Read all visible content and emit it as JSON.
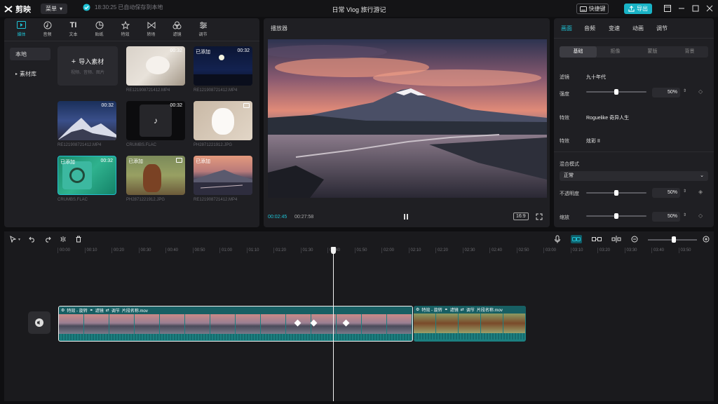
{
  "app": {
    "name": "剪映",
    "menu": "菜单",
    "save_status": "18:30:25 已自动保存到本地",
    "project_title": "日常 Vlog 旅行游记",
    "shortcut": "快捷键",
    "export": "导出"
  },
  "colors": {
    "accent": "#1fc3d6",
    "clip": "#1c7f80",
    "panel": "#1f1f23"
  },
  "media": {
    "tabs": [
      {
        "label": "媒体",
        "icon": "media-icon"
      },
      {
        "label": "音频",
        "icon": "audio-icon"
      },
      {
        "label": "文本",
        "icon": "text-icon"
      },
      {
        "label": "贴纸",
        "icon": "sticker-icon"
      },
      {
        "label": "特效",
        "icon": "effects-icon"
      },
      {
        "label": "转场",
        "icon": "transition-icon"
      },
      {
        "label": "滤镜",
        "icon": "filter-icon"
      },
      {
        "label": "调节",
        "icon": "adjust-icon"
      }
    ],
    "side": [
      "本地",
      "素材库"
    ],
    "import_label": "导入素材",
    "import_hint": "视频、音频、图片",
    "items": [
      {
        "name": "RE121908721412.MP4",
        "duration": "00:32",
        "added": ""
      },
      {
        "name": "RE121908721412.MP4",
        "duration": "00:32",
        "added": "已添加"
      },
      {
        "name": "RE121908721412.MP4",
        "duration": "00:32",
        "added": ""
      },
      {
        "name": "CRUMBS.FLAC",
        "duration": "00:32",
        "added": ""
      },
      {
        "name": "PH2871221912.JPG",
        "duration": "",
        "added": ""
      },
      {
        "name": "CRUMBS.FLAC",
        "duration": "00:32",
        "added": "已添加"
      },
      {
        "name": "PH2871221912.JPG",
        "duration": "",
        "added": "已添加"
      },
      {
        "name": "RE121908721412.MP4",
        "duration": "",
        "added": "已添加"
      }
    ]
  },
  "player": {
    "title": "播放器",
    "current": "00:02:45",
    "total": "00:27:58",
    "ratio": "16:9"
  },
  "props": {
    "tabs": [
      "画面",
      "音频",
      "变速",
      "动画",
      "调节"
    ],
    "segments": [
      "基础",
      "抠像",
      "蒙版",
      "背景"
    ],
    "filter_label": "滤镜",
    "filter_value": "九十年代",
    "strength_label": "强度",
    "strength_value": "50%",
    "strength": 0.5,
    "effect_label": "特效",
    "effect_value": "Roguelike  奇异人生",
    "effect2_label": "特效",
    "effect2_value": "炫彩 II",
    "blend_label": "混合模式",
    "blend_value": "正常",
    "opacity_label": "不透明度",
    "opacity_value": "50%",
    "opacity": 0.5,
    "scale_label": "缩放",
    "scale_value": "50%",
    "scale": 0.5
  },
  "timeline": {
    "ticks": [
      "00:00",
      "00:10",
      "00:20",
      "00:30",
      "00:40",
      "00:50",
      "01:00",
      "01:10",
      "01:20",
      "01:30",
      "01:40",
      "01:50",
      "02:00",
      "02:10",
      "02:20",
      "02:30",
      "02:40",
      "02:50",
      "03:00",
      "03:10",
      "03:20",
      "03:30",
      "03:40",
      "03:50"
    ],
    "clip1_tags": [
      "特效 - 旋转",
      "滤镜",
      "调节",
      "片段名称.mov"
    ],
    "clip2_tags": [
      "特效 - 旋转",
      "滤镜",
      "调节",
      "片段名称.mov"
    ]
  }
}
